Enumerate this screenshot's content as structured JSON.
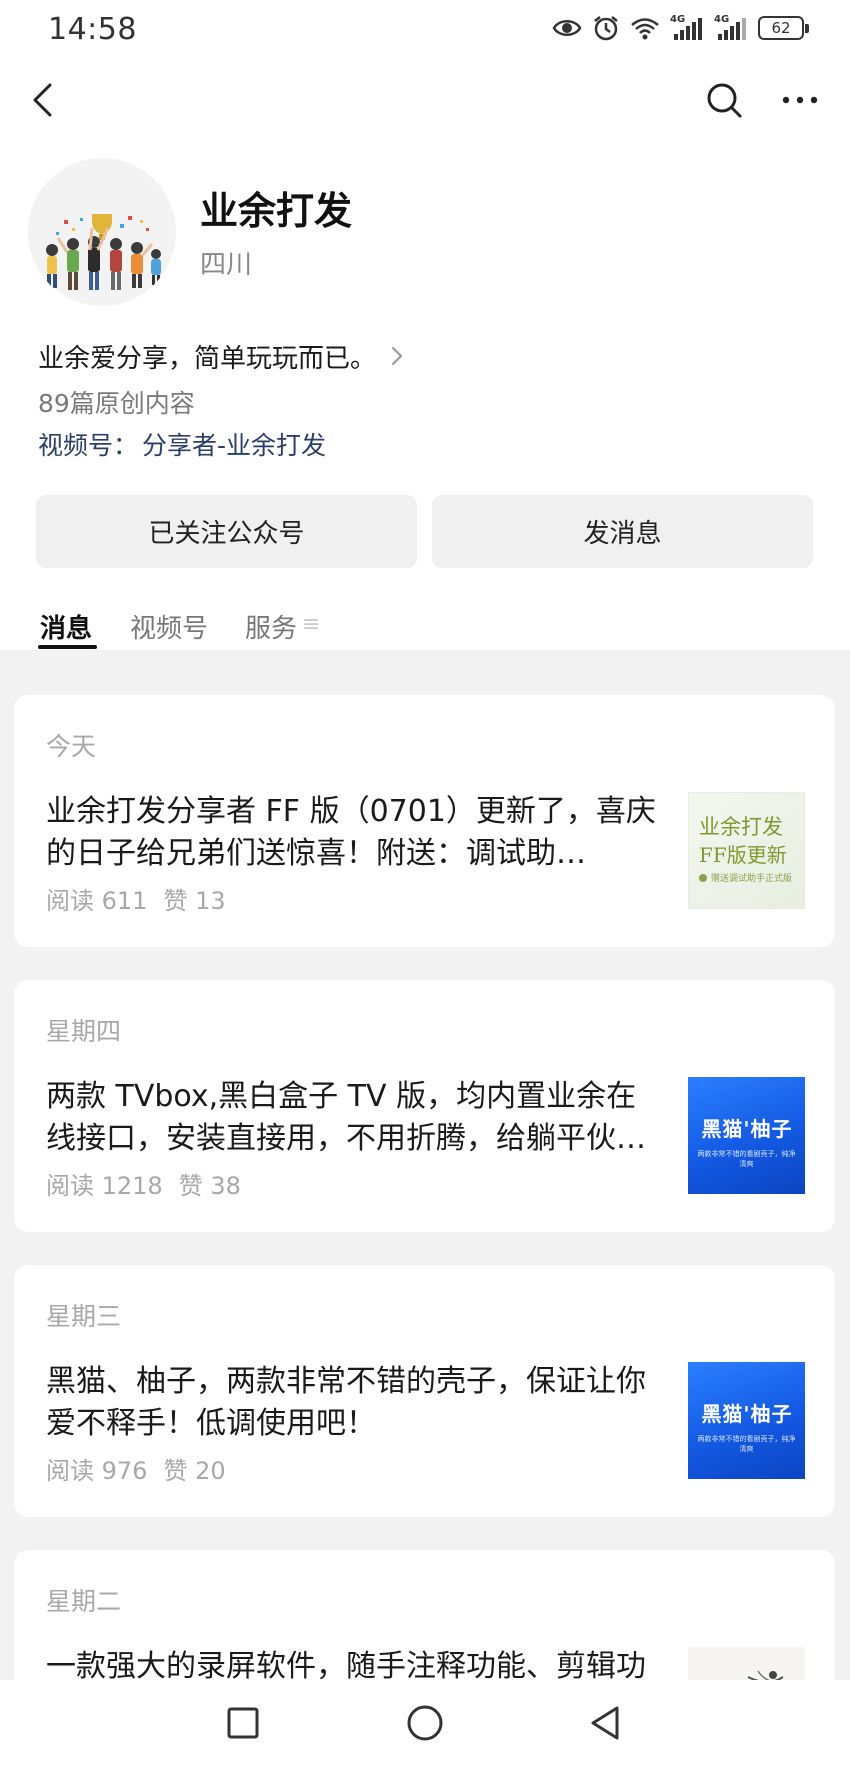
{
  "status_bar": {
    "time": "14:58",
    "battery": "62",
    "icons": [
      "eye-icon",
      "alarm-icon",
      "wifi-icon",
      "signal-4g-icon",
      "signal-4g-icon",
      "battery-icon"
    ],
    "network_1": "4G",
    "network_2": "4G"
  },
  "nav": {
    "back_icon": "back-arrow-icon",
    "search_icon": "search-icon",
    "more_icon": "more-icon"
  },
  "profile": {
    "name": "业余打发",
    "region": "四川",
    "bio": "业余爱分享，简单玩玩而已。",
    "original_count": "89篇原创内容",
    "video_label": "视频号：",
    "video_name": "分享者-业余打发"
  },
  "buttons": {
    "follow": "已关注公众号",
    "message": "发消息"
  },
  "tabs": [
    {
      "label": "消息",
      "active": true
    },
    {
      "label": "视频号",
      "active": false
    },
    {
      "label": "服务",
      "active": false
    }
  ],
  "articles": [
    {
      "date": "今天",
      "title": "业余打发分享者 FF 版（0701）更新了，喜庆的日子给兄弟们送惊喜！附送：调试助…",
      "reads": "阅读 611",
      "likes": "赞 13",
      "thumb": {
        "line1": "业余打发",
        "line2": "FF版更新",
        "line3": "赠送调试助手正式版"
      }
    },
    {
      "date": "星期四",
      "title": "两款 TVbox,黑白盒子 TV 版，均内置业余在线接口，安装直接用，不用折腾，给躺平伙…",
      "reads": "阅读 1218",
      "likes": "赞 38",
      "thumb": {
        "line1": "黑猫'柚子",
        "line2": "两款非常不错的看剧壳子，纯净清爽"
      }
    },
    {
      "date": "星期三",
      "title": "黑猫、柚子，两款非常不错的壳子，保证让你爱不释手！低调使用吧！",
      "reads": "阅读 976",
      "likes": "赞 20",
      "thumb": {
        "line1": "黑猫'柚子",
        "line2": "两款非常不错的看剧壳子，纯净清爽"
      }
    },
    {
      "date": "星期二",
      "title": "一款强大的录屏软件，随手注释功能、剪辑功",
      "reads": "",
      "likes": "",
      "thumb": {}
    }
  ],
  "system_nav": {
    "recent": "square-icon",
    "home": "circle-icon",
    "back": "triangle-back-icon"
  },
  "colors": {
    "link": "#2a3e6b",
    "feed_bg": "#f2f2f2",
    "button_bg": "#f0f0f0",
    "meta_gray": "#a8a8a8"
  }
}
